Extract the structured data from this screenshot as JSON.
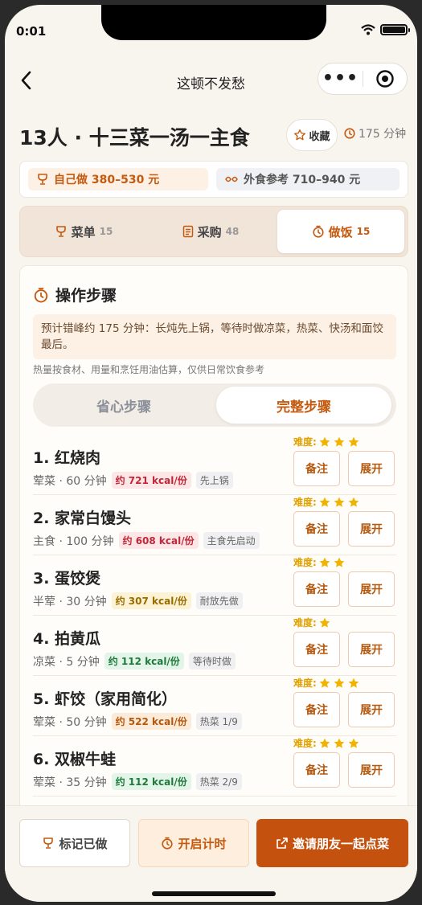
{
  "status": {
    "time": "0:01"
  },
  "nav": {
    "title": "这顿不发愁",
    "more": "•••"
  },
  "header": {
    "title": "13人 · 十三菜一汤一主食",
    "fav_label": "收藏",
    "total_time": "175 分钟"
  },
  "cost": {
    "self": "自己做 380–530 元",
    "outside": "外食参考 710–940 元"
  },
  "tabs": [
    {
      "label": "菜单",
      "count": "15"
    },
    {
      "label": "采购",
      "count": "48"
    },
    {
      "label": "做饭",
      "count": "15"
    }
  ],
  "steps_section": {
    "title": "操作步骤",
    "note": "预计错峰约 175 分钟：长炖先上锅，等待时做凉菜，热菜、快汤和面饺最后。",
    "hint": "热量按食材、用量和烹饪用油估算，仅供日常饮食参考",
    "mode_simple": "省心步骤",
    "mode_full": "完整步骤",
    "difficulty_label": "难度:",
    "note_btn": "备注",
    "expand_btn": "展开"
  },
  "steps": [
    {
      "name": "1. 红烧肉",
      "meta": "荤菜 · 60 分钟",
      "kcal": "约 721 kcal/份",
      "kcal_color": "red",
      "tag": "先上锅",
      "stars": 3
    },
    {
      "name": "2. 家常白馒头",
      "meta": "主食 · 100 分钟",
      "kcal": "约 608 kcal/份",
      "kcal_color": "red",
      "tag": "主食先启动",
      "stars": 3
    },
    {
      "name": "3. 蛋饺煲",
      "meta": "半荤 · 30 分钟",
      "kcal": "约 307 kcal/份",
      "kcal_color": "yellow",
      "tag": "耐放先做",
      "stars": 2
    },
    {
      "name": "4. 拍黄瓜",
      "meta": "凉菜 · 5 分钟",
      "kcal": "约 112 kcal/份",
      "kcal_color": "green",
      "tag": "等待时做",
      "stars": 1
    },
    {
      "name": "5. 虾饺（家用简化）",
      "meta": "荤菜 · 50 分钟",
      "kcal": "约 522 kcal/份",
      "kcal_color": "orange",
      "tag": "热菜 1/9",
      "stars": 3
    },
    {
      "name": "6. 双椒牛蛙",
      "meta": "荤菜 · 35 分钟",
      "kcal": "约 112 kcal/份",
      "kcal_color": "green",
      "tag": "热菜 2/9",
      "stars": 3
    }
  ],
  "bottom": {
    "mark_done": "标记已做",
    "start_timer": "开启计时",
    "invite": "邀请朋友一起点菜"
  }
}
